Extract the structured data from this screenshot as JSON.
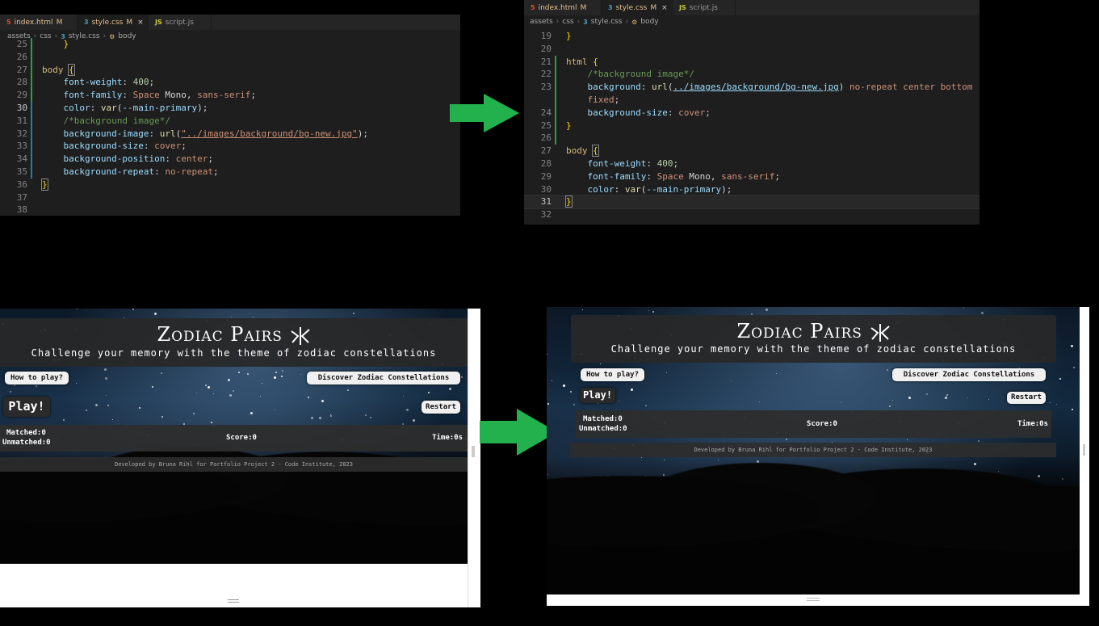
{
  "editor_before": {
    "tabs": [
      {
        "name": "index.html",
        "badge": "M",
        "icon": "html-icon",
        "active": false
      },
      {
        "name": "style.css",
        "badge": "M",
        "icon": "css-icon",
        "active": true,
        "close": "×"
      },
      {
        "name": "script.js",
        "badge": "",
        "icon": "js-icon",
        "active": false
      }
    ],
    "breadcrumb": [
      "assets",
      "css",
      "style.css",
      "body"
    ],
    "lines": [
      "25",
      "26",
      "27",
      "28",
      "29",
      "30",
      "31",
      "32",
      "33",
      "34",
      "35",
      "36",
      "37",
      "38"
    ],
    "code": {
      "l27_sel": "body",
      "l27_br": "{",
      "l28_prop": "font-weight",
      "l28_val": "400",
      "l29_prop": "font-family",
      "l29_val1": "Space",
      "l29_val2": " Mono, ",
      "l29_val3": "sans-serif",
      "l30_prop": "color",
      "l30_fn": "var",
      "l30_var": "--main-primary",
      "l31_com": "/*background image*/",
      "l32_prop": "background-image",
      "l32_fn": "url",
      "l32_str": "\"../images/background/bg-new.jpg\"",
      "l33_prop": "background-size",
      "l33_val": "cover",
      "l34_prop": "background-position",
      "l34_val": "center",
      "l35_prop": "background-repeat",
      "l35_val": "no-repeat",
      "l36_br": "}"
    }
  },
  "editor_after": {
    "tabs": [
      {
        "name": "index.html",
        "badge": "M",
        "icon": "html-icon",
        "active": false
      },
      {
        "name": "style.css",
        "badge": "M",
        "icon": "css-icon",
        "active": true,
        "close": "×"
      },
      {
        "name": "script.js",
        "badge": "",
        "icon": "js-icon",
        "active": false
      }
    ],
    "breadcrumb": [
      "assets",
      "css",
      "style.css",
      "body"
    ],
    "lines": [
      "19",
      "20",
      "21",
      "22",
      "23",
      "",
      "24",
      "25",
      "26",
      "27",
      "28",
      "29",
      "30",
      "31",
      "32"
    ],
    "code": {
      "l19_br": "}",
      "l21_sel": "html",
      "l21_br": "{",
      "l22_com": "/*background image*/",
      "l23_prop": "background",
      "l23_fn": "url",
      "l23_str": "../images/background/bg-new.jpg",
      "l23_val": "no-repeat center bottom",
      "l23b_val": "fixed",
      "l24_prop": "background-size",
      "l24_val": "cover",
      "l25_br": "}",
      "l27_sel": "body",
      "l27_br": "{",
      "l28_prop": "font-weight",
      "l28_val": "400",
      "l29_prop": "font-family",
      "l29_val1": "Space",
      "l29_val2": " Mono, ",
      "l29_val3": "sans-serif",
      "l30_prop": "color",
      "l30_fn": "var",
      "l30_var": "--main-primary",
      "l31_br": "}"
    }
  },
  "game": {
    "title": "Zodiac Pairs",
    "subtitle": "Challenge your memory with the theme of zodiac constellations",
    "how_to_play": "How to play?",
    "discover": "Discover Zodiac Constellations",
    "play": "Play!",
    "restart": "Restart",
    "matched": "Matched:0",
    "unmatched": "Unmatched:0",
    "score": "Score:0",
    "time": "Time:0s",
    "footer_before": "Developed by Bruna Rihl for Portfolio Project 2 - Code Institute, 2023",
    "footer_after": "Developed by Bruna Rihl for Portfolio Project 2 - Code Institute, 2023"
  },
  "colors": {
    "arrow": "#22b14c",
    "editor_bg": "#1e1e1e",
    "panel_bg": "#282828"
  }
}
